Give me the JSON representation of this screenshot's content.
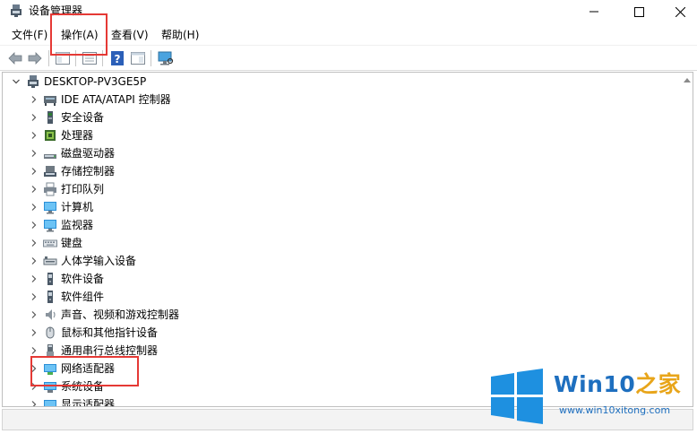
{
  "window": {
    "title": "设备管理器",
    "icon": "device-manager-icon"
  },
  "menu": [
    "文件(F)",
    "操作(A)",
    "查看(V)",
    "帮助(H)"
  ],
  "toolbar": [
    "back-arrow-icon",
    "forward-arrow-icon",
    "show-hide-tree-icon",
    "properties-icon",
    "help-icon",
    "view-icon",
    "scan-hardware-icon"
  ],
  "tree": {
    "root": "DESKTOP-PV3GE5P",
    "items": [
      {
        "label": "IDE ATA/ATAPI 控制器",
        "icon": "ide-controller-icon"
      },
      {
        "label": "安全设备",
        "icon": "security-device-icon"
      },
      {
        "label": "处理器",
        "icon": "processor-icon"
      },
      {
        "label": "磁盘驱动器",
        "icon": "disk-drive-icon"
      },
      {
        "label": "存储控制器",
        "icon": "storage-controller-icon"
      },
      {
        "label": "打印队列",
        "icon": "printer-icon"
      },
      {
        "label": "计算机",
        "icon": "computer-icon"
      },
      {
        "label": "监视器",
        "icon": "monitor-icon"
      },
      {
        "label": "键盘",
        "icon": "keyboard-icon"
      },
      {
        "label": "人体学输入设备",
        "icon": "hid-icon"
      },
      {
        "label": "软件设备",
        "icon": "software-device-icon"
      },
      {
        "label": "软件组件",
        "icon": "software-component-icon"
      },
      {
        "label": "声音、视频和游戏控制器",
        "icon": "sound-icon"
      },
      {
        "label": "鼠标和其他指针设备",
        "icon": "mouse-icon"
      },
      {
        "label": "通用串行总线控制器",
        "icon": "usb-icon"
      },
      {
        "label": "网络适配器",
        "icon": "network-adapter-icon"
      },
      {
        "label": "系统设备",
        "icon": "system-device-icon"
      },
      {
        "label": "显示适配器",
        "icon": "display-adapter-icon"
      }
    ]
  },
  "watermark": {
    "brand_main": "Win10",
    "brand_accent": "之家",
    "url": "www.win10xitong.com"
  },
  "colors": {
    "annotation": "#e53935",
    "brand_blue": "#1e6fbf",
    "brand_orange": "#e8a51a"
  }
}
